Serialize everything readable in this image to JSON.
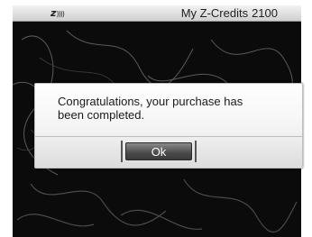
{
  "status_bar": {
    "logo_letter": "z",
    "logo_waves": "))))",
    "credits_label": "My Z-Credits",
    "credits_value": "2100"
  },
  "dialog": {
    "message": "Congratulations, your purchase has been completed.",
    "ok_label": "Ok"
  },
  "colors": {
    "background": "#0b0b0b",
    "dialog": "#f3f3f3",
    "button": "#4a4a4a"
  }
}
